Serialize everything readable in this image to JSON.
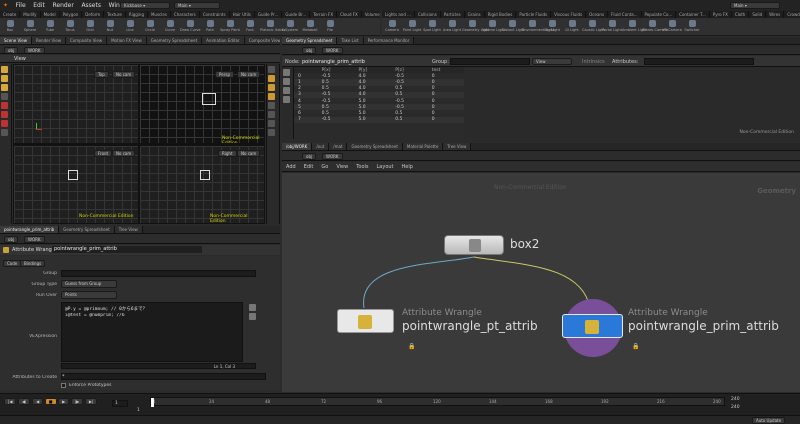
{
  "menu": [
    "File",
    "Edit",
    "Render",
    "Assets",
    "Windows",
    "Help"
  ],
  "toolbar": {
    "desktop": "Kickbase",
    "network_path": "Main",
    "right_combo": "Main"
  },
  "shelf_tabs_left": [
    "Create",
    "Modify",
    "Model",
    "Polygon",
    "Deform",
    "Texture",
    "Rigging",
    "Muscles",
    "Characters",
    "Constraints",
    "Hair Utils",
    "Guide Pr...",
    "Guide Br...",
    "Terrain FX",
    "Cloud FX",
    "Volume",
    "Kickbase"
  ],
  "shelf_tabs_right": [
    "Lights and ...",
    "Collisions",
    "Particles",
    "Grains",
    "Rigid Bodies",
    "Particle Fluids",
    "Viscous Fluids",
    "Oceans",
    "Fluid Conta...",
    "Populate Co...",
    "Container T...",
    "Pyro FX",
    "Cloth",
    "Solid",
    "Wires",
    "Crowds",
    "Drive Simul..."
  ],
  "shelf_tools_left": [
    "Box",
    "Sphere",
    "Tube",
    "Torus",
    "Grid",
    "Null",
    "Line",
    "Circle",
    "Curve",
    "Draw Curve",
    "Path",
    "Spray Paint",
    "Font",
    "Platonic Solids",
    "L-System",
    "Metaball",
    "File"
  ],
  "shelf_tools_right": [
    "Camera",
    "Point Light",
    "Spot Light",
    "Area Light",
    "Geometry Light",
    "Volume Light",
    "Distant Light",
    "Environment Light",
    "Sky Light",
    "GI Light",
    "Caustic Light",
    "Portal Light",
    "Ambient Light",
    "Stereo Camera",
    "VR Camera",
    "Switcher"
  ],
  "viewport": {
    "tabs": [
      "Scene View",
      "Render View",
      "Composite View",
      "Motion FX View",
      "Geometry Spreadsheet",
      "Animation Editor",
      "Composite View"
    ],
    "path": "obj",
    "network": "WORK",
    "title": "View",
    "watermark": "Non-Commercial Edition",
    "views": [
      {
        "name": "Top",
        "cam": "No cam"
      },
      {
        "name": "Persp",
        "cam": "No cam"
      },
      {
        "name": "Front",
        "cam": "No cam"
      },
      {
        "name": "Right",
        "cam": "No cam"
      }
    ],
    "axis_labels": [
      "Z",
      "X",
      "Y"
    ]
  },
  "spreadsheet": {
    "tabs": [
      "Geometry Spreadsheet",
      "Take List",
      "Performance Monitor"
    ],
    "path": "obj",
    "network": "WORK",
    "node_label": "Node:",
    "node": "pointwrangle_prim_attrib",
    "group_label": "Group:",
    "view_label": "View",
    "intrinsics_label": "Intrinsics",
    "attributes_label": "Attributes:",
    "columns": [
      "",
      "P[x]",
      "P[y]",
      "P[z]",
      "test"
    ],
    "rows": [
      [
        "0",
        "-0.5",
        "4.0",
        "-0.5",
        "0"
      ],
      [
        "1",
        "0.5",
        "4.0",
        "-0.5",
        "0"
      ],
      [
        "2",
        "0.5",
        "4.0",
        "0.5",
        "0"
      ],
      [
        "3",
        "-0.5",
        "4.0",
        "0.5",
        "0"
      ],
      [
        "4",
        "-0.5",
        "5.0",
        "-0.5",
        "0"
      ],
      [
        "5",
        "0.5",
        "5.0",
        "-0.5",
        "0"
      ],
      [
        "6",
        "0.5",
        "5.0",
        "0.5",
        "0"
      ],
      [
        "7",
        "-0.5",
        "5.0",
        "0.5",
        "0"
      ]
    ],
    "watermark": "Non-Commercial Edition"
  },
  "params": {
    "tabs": [
      "pointwrangle_prim_attrib",
      "Geometry Spreadsheet",
      "Tree View"
    ],
    "path": "obj",
    "network": "WORK",
    "node_type": "Attribute Wrangle",
    "node_name": "pointwrangle_prim_attrib",
    "subtabs": [
      "Code",
      "Bindings"
    ],
    "group_label": "Group",
    "group_value": "",
    "group_type_label": "Group Type",
    "group_type_value": "Guess from Group",
    "run_over_label": "Run Over",
    "run_over_value": "Points",
    "vex_label": "VEXpression",
    "code_line1": "@P.y = @primnum; // 0から6まで？",
    "code_line2": "i@test = @numprim; //6",
    "cursor_pos": "Ln 1, Col 3",
    "attrs_label": "Attributes to Create",
    "attrs_value": "*",
    "enforce_label": "Enforce Prototypes"
  },
  "network": {
    "tabs": [
      "/obj/WORK",
      "/out",
      "/mat",
      "Geometry Spreadsheet",
      "Material Palette",
      "Tree View"
    ],
    "path": "obj",
    "network": "WORK",
    "menu": [
      "Add",
      "Edit",
      "Go",
      "View",
      "Tools",
      "Layout",
      "Help"
    ],
    "watermark": "Non-Commercial Edition",
    "context": "Geometry",
    "nodes": [
      {
        "name": "box2",
        "type": ""
      },
      {
        "name": "pointwrangle_pt_attrib",
        "type": "Attribute Wrangle"
      },
      {
        "name": "pointwrangle_prim_attrib",
        "type": "Attribute Wrangle"
      }
    ]
  },
  "timeline": {
    "ticks": [
      "1",
      "24",
      "48",
      "72",
      "96",
      "120",
      "144",
      "168",
      "192",
      "216",
      "240"
    ],
    "current_frame": "1",
    "start": "1",
    "end_a": "240",
    "end_b": "240",
    "auto_update": "Auto Update"
  }
}
